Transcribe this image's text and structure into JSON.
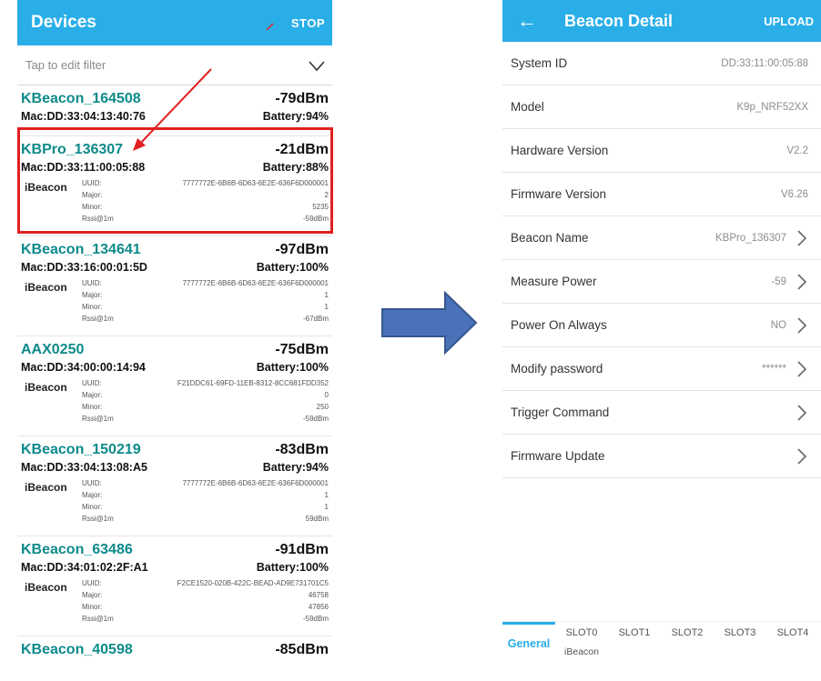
{
  "left": {
    "title": "Devices",
    "stop_label": "STOP",
    "filter_placeholder": "Tap to edit filter",
    "devices": [
      {
        "name": "KBeacon_164508",
        "rssi": "-79dBm",
        "mac": "Mac:DD:33:04:13:40:76",
        "battery": "Battery:94%"
      },
      {
        "name": "KBPro_136307",
        "rssi": "-21dBm",
        "mac": "Mac:DD:33:11:00:05:88",
        "battery": "Battery:88%",
        "type": "iBeacon",
        "uuid": "7777772E-6B6B-6D63-6E2E-636F6D000001",
        "major": "2",
        "minor": "5235",
        "rssi1m": "-59dBm"
      },
      {
        "name": "KBeacon_134641",
        "rssi": "-97dBm",
        "mac": "Mac:DD:33:16:00:01:5D",
        "battery": "Battery:100%",
        "type": "iBeacon",
        "uuid": "7777772E-6B6B-6D63-6E2E-636F6D000001",
        "major": "1",
        "minor": "1",
        "rssi1m": "-67dBm"
      },
      {
        "name": "AAX0250",
        "rssi": "-75dBm",
        "mac": "Mac:DD:34:00:00:14:94",
        "battery": "Battery:100%",
        "type": "iBeacon",
        "uuid": "F21DDC61-69FD-11EB-8312-8CC681FDD352",
        "major": "0",
        "minor": "250",
        "rssi1m": "-59dBm"
      },
      {
        "name": "KBeacon_150219",
        "rssi": "-83dBm",
        "mac": "Mac:DD:33:04:13:08:A5",
        "battery": "Battery:94%",
        "type": "iBeacon",
        "uuid": "7777772E-6B6B-6D63-6E2E-636F6D000001",
        "major": "1",
        "minor": "1",
        "rssi1m": "59dBm"
      },
      {
        "name": "KBeacon_63486",
        "rssi": "-91dBm",
        "mac": "Mac:DD:34:01:02:2F:A1",
        "battery": "Battery:100%",
        "type": "iBeacon",
        "uuid": "F2CE1520-020B-422C-BEAD-AD9E731701C5",
        "major": "46758",
        "minor": "47856",
        "rssi1m": "-59dBm"
      },
      {
        "name": "KBeacon_40598",
        "rssi": "-85dBm"
      }
    ],
    "field_labels": {
      "uuid": "UUID:",
      "major": "Major:",
      "minor": "Minor:",
      "rssi1m": "Rssi@1m"
    }
  },
  "right": {
    "back_icon": "arrow-left-icon",
    "title": "Beacon Detail",
    "upload_label": "UPLOAD",
    "rows": [
      {
        "label": "System ID",
        "value": "DD:33:11:00:05:88",
        "chevron": false
      },
      {
        "label": "Model",
        "value": "K9p_NRF52XX",
        "chevron": false
      },
      {
        "label": "Hardware Version",
        "value": "V2.2",
        "chevron": false
      },
      {
        "label": "Firmware Version",
        "value": "V6.26",
        "chevron": false
      },
      {
        "label": "Beacon Name",
        "value": "KBPro_136307",
        "chevron": true
      },
      {
        "label": "Measure Power",
        "value": "-59",
        "chevron": true
      },
      {
        "label": "Power On Always",
        "value": "NO",
        "chevron": true
      },
      {
        "label": "Modify password",
        "value": "******",
        "chevron": true
      },
      {
        "label": "Trigger Command",
        "value": "",
        "chevron": true
      },
      {
        "label": "Firmware Update",
        "value": "",
        "chevron": true
      }
    ],
    "tabs": [
      {
        "label": "General",
        "active": true
      },
      {
        "label": "SLOT0",
        "sub": "iBeacon"
      },
      {
        "label": "SLOT1"
      },
      {
        "label": "SLOT2"
      },
      {
        "label": "SLOT3"
      },
      {
        "label": "SLOT4"
      }
    ]
  },
  "colors": {
    "accent": "#2aaee8",
    "device_name": "#0e8a8a",
    "highlight": "#e02020",
    "arrow_fill": "#4a72b8"
  }
}
